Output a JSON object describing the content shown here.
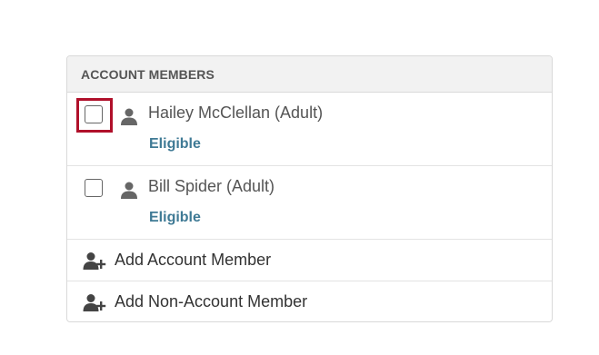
{
  "panel": {
    "title": "ACCOUNT MEMBERS"
  },
  "members": [
    {
      "name": "Hailey McClellan (Adult)",
      "status": "Eligible",
      "checked": false,
      "focused": true
    },
    {
      "name": "Bill Spider (Adult)",
      "status": "Eligible",
      "checked": false,
      "focused": false
    }
  ],
  "actions": [
    {
      "label": "Add Account Member",
      "icon": "add-user-icon"
    },
    {
      "label": "Add Non-Account Member",
      "icon": "add-user-icon"
    }
  ],
  "colors": {
    "focus_border": "#b0102a",
    "status_text": "#3f7a95",
    "header_bg": "#f2f2f2"
  }
}
